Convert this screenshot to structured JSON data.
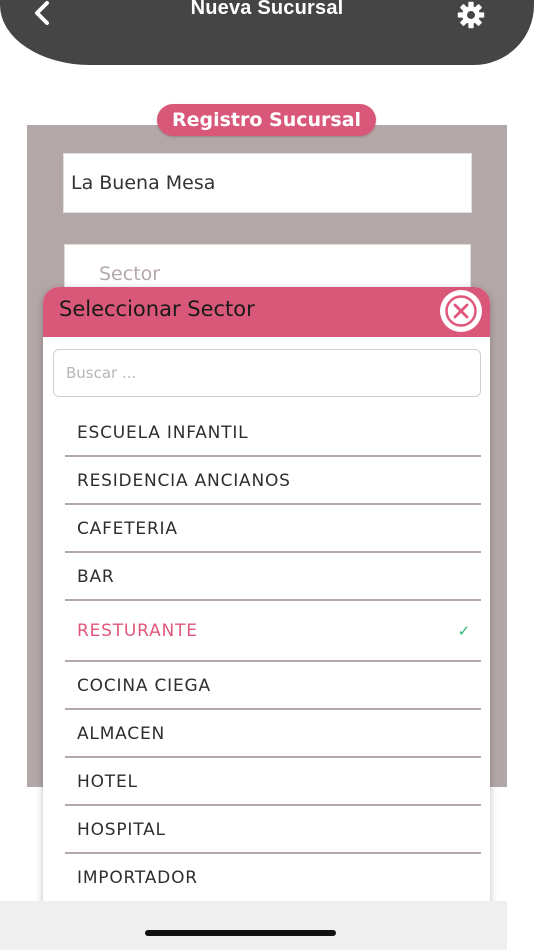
{
  "header": {
    "title": "Nueva Sucursal",
    "back_icon": "chevron-left-icon",
    "settings_icon": "gear-icon",
    "background_color": "#454545"
  },
  "form": {
    "section_label": "Registro Sucursal",
    "name_value": "La Buena Mesa",
    "sector_placeholder": "Sector",
    "accent_color": "#d9587a",
    "panel_color": "#b4a7a8"
  },
  "modal": {
    "title": "Seleccionar Sector",
    "close_icon": "close-circle-icon",
    "search_placeholder": "Buscar ...",
    "items": [
      {
        "label": "ESCUELA INFANTIL",
        "selected": false
      },
      {
        "label": "RESIDENCIA ANCIANOS",
        "selected": false
      },
      {
        "label": "CAFETERIA",
        "selected": false
      },
      {
        "label": "BAR",
        "selected": false
      },
      {
        "label": "RESTURANTE",
        "selected": true
      },
      {
        "label": "COCINA CIEGA",
        "selected": false
      },
      {
        "label": "ALMACEN",
        "selected": false
      },
      {
        "label": "HOTEL",
        "selected": false
      },
      {
        "label": "HOSPITAL",
        "selected": false
      },
      {
        "label": "IMPORTADOR",
        "selected": false
      }
    ],
    "check_mark": "✓",
    "selected_color": "#e0577b",
    "check_color": "#2bb673"
  }
}
